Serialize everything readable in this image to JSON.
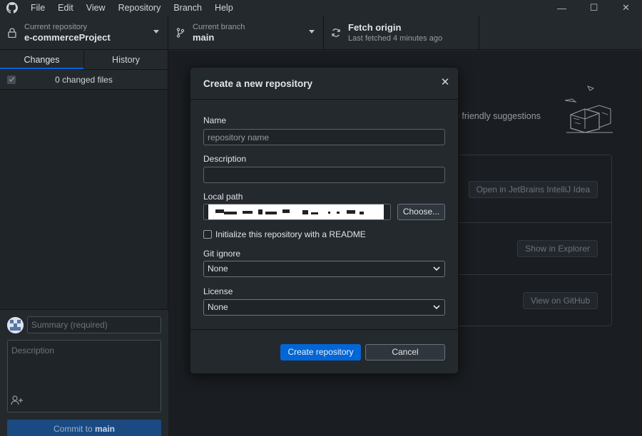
{
  "menu": [
    "File",
    "Edit",
    "View",
    "Repository",
    "Branch",
    "Help"
  ],
  "window_controls": {
    "minimize": "—",
    "maximize": "☐",
    "close": "✕"
  },
  "toolbar": {
    "repo_label": "Current repository",
    "repo_value": "e-commerceProject",
    "branch_label": "Current branch",
    "branch_value": "main",
    "fetch_label": "Fetch origin",
    "fetch_sub": "Last fetched 4 minutes ago"
  },
  "sidebar": {
    "tab_changes": "Changes",
    "tab_history": "History",
    "changed_files": "0 changed files",
    "summary_placeholder": "Summary (required)",
    "description_placeholder": "Description",
    "commit_prefix": "Commit to ",
    "commit_branch": "main"
  },
  "main": {
    "friendly_text": "e friendly suggestions",
    "open_ide": "Open in JetBrains IntelliJ Idea",
    "show_explorer": "Show in Explorer",
    "view_github": "View on GitHub"
  },
  "dialog": {
    "title": "Create a new repository",
    "name_label": "Name",
    "name_placeholder": "repository name",
    "description_label": "Description",
    "local_path_label": "Local path",
    "choose_button": "Choose...",
    "readme_label": "Initialize this repository with a README",
    "gitignore_label": "Git ignore",
    "gitignore_value": "None",
    "license_label": "License",
    "license_value": "None",
    "create_button": "Create repository",
    "cancel_button": "Cancel"
  },
  "colors": {
    "background": "#24292e",
    "primary": "#0366d6",
    "border": "#141414"
  }
}
